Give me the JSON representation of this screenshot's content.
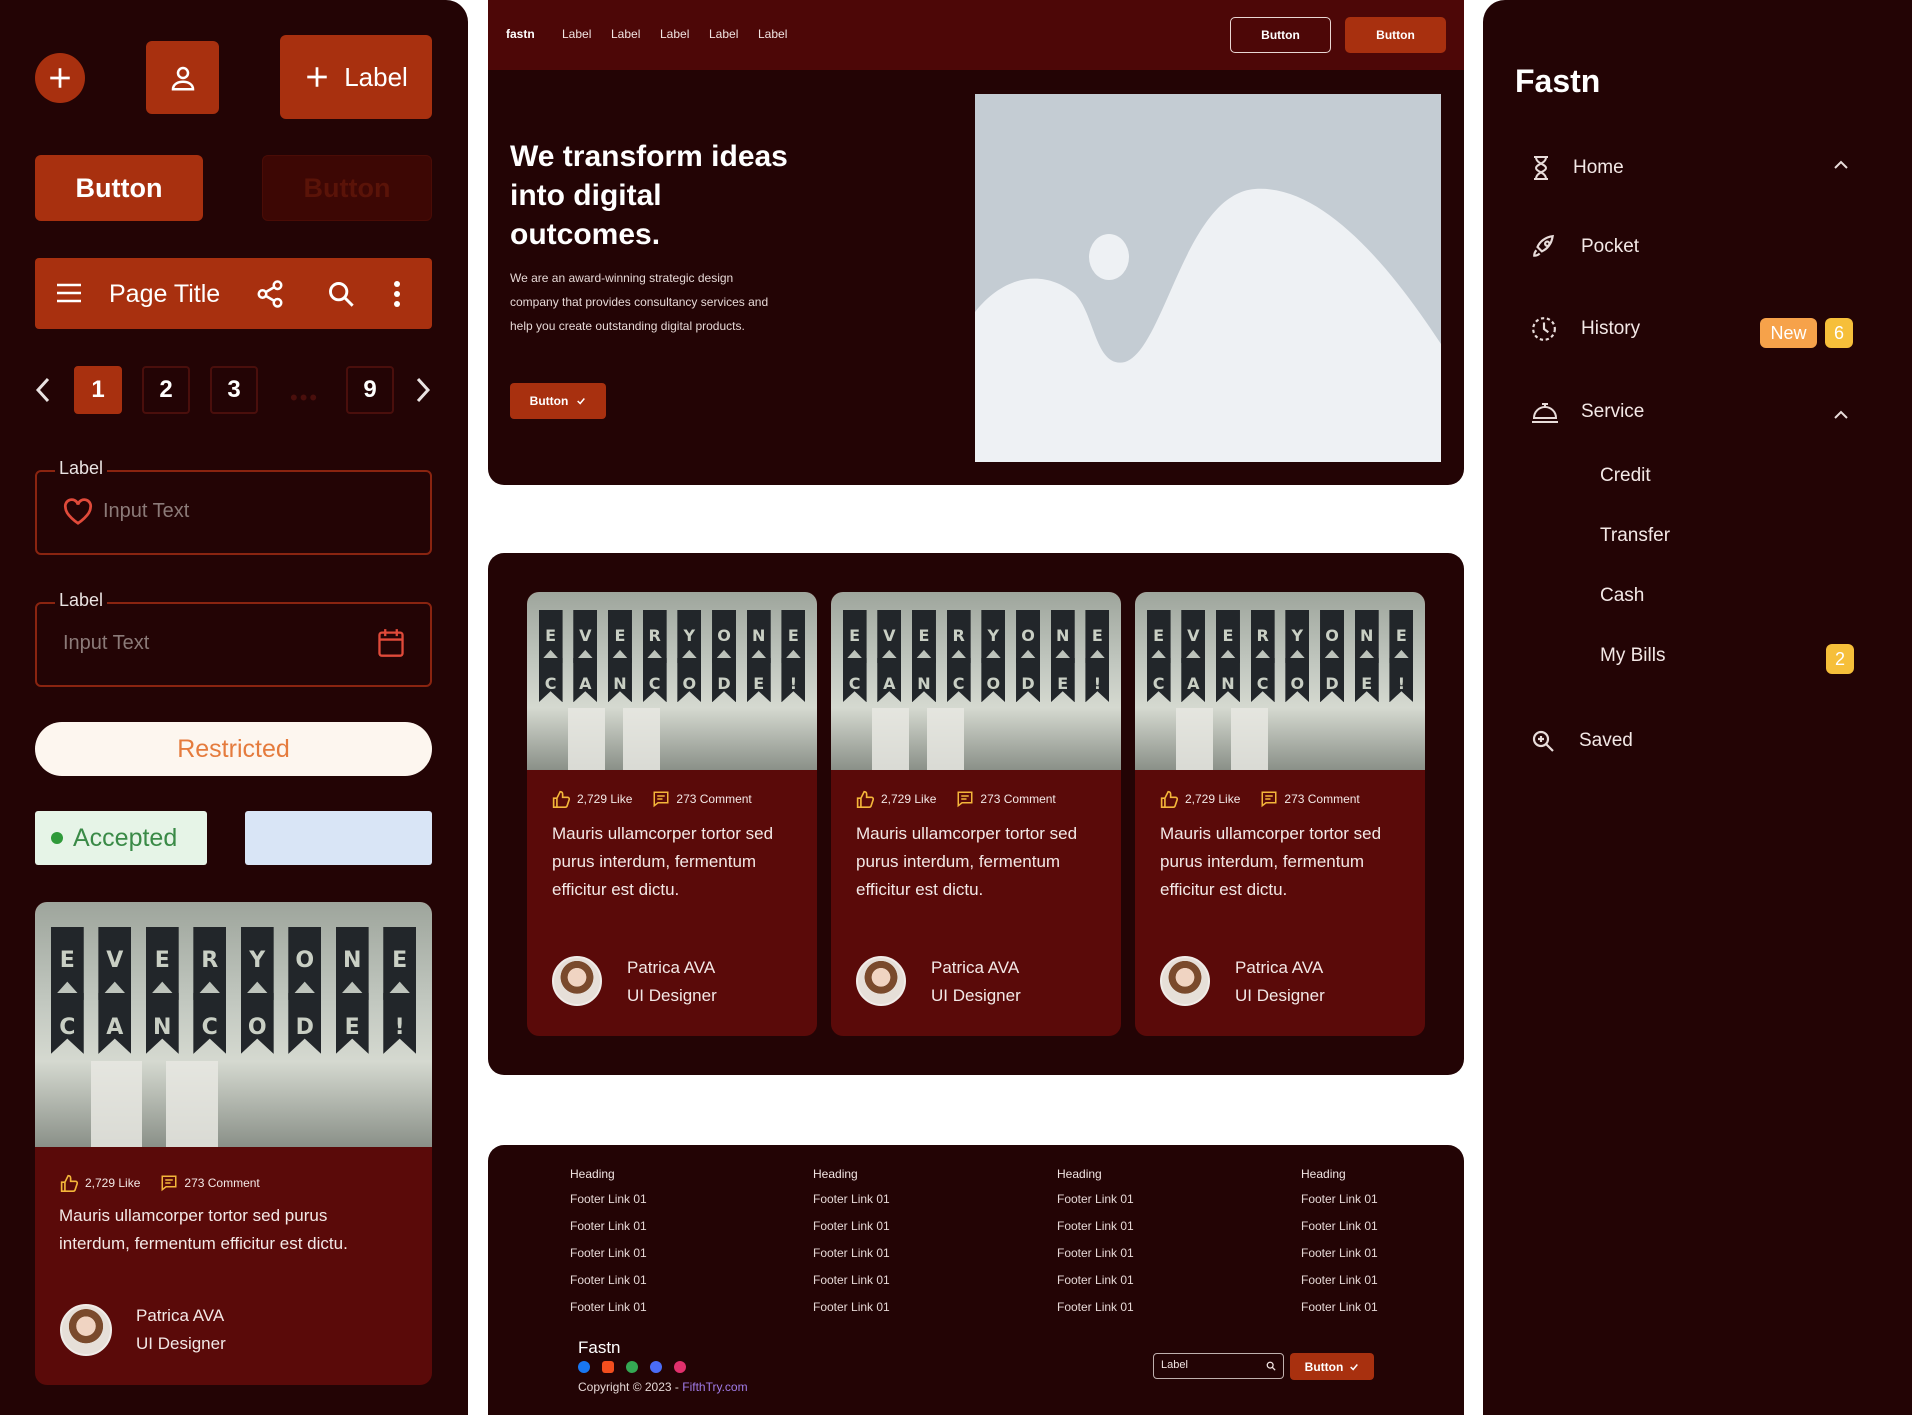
{
  "left": {
    "label_button": "Label",
    "primary_button": "Button",
    "disabled_button": "Button",
    "app_bar_title": "Page Title",
    "pagination": [
      "1",
      "2",
      "3",
      "9"
    ],
    "field1": {
      "label": "Label",
      "value": "Input Text"
    },
    "field2": {
      "label": "Label",
      "value": "Input Text"
    },
    "pill": "Restricted",
    "accepted": "Accepted",
    "card": {
      "likes": "2,729 Like",
      "comments": "273 Comment",
      "text": "Mauris ullamcorper tortor sed purus interdum, fermentum efficitur est dictu.",
      "name": "Patrica AVA",
      "role": "UI Designer"
    }
  },
  "hero": {
    "logo": "fastn",
    "nav": [
      "Label",
      "Label",
      "Label",
      "Label",
      "Label"
    ],
    "btn_outline": "Button",
    "btn_fill": "Button",
    "title": "We transform ideas into digital outcomes.",
    "description": "We are an award-winning strategic design company that provides consultancy services and help you create outstanding digital products.",
    "cta": "Button"
  },
  "cards": [
    {
      "likes": "2,729 Like",
      "comments": "273 Comment",
      "text": "Mauris ullamcorper tortor sed purus interdum, fermentum efficitur est dictu.",
      "name": "Patrica AVA",
      "role": "UI Designer"
    },
    {
      "likes": "2,729 Like",
      "comments": "273 Comment",
      "text": "Mauris ullamcorper tortor sed purus interdum, fermentum efficitur est dictu.",
      "name": "Patrica AVA",
      "role": "UI Designer"
    },
    {
      "likes": "2,729 Like",
      "comments": "273 Comment",
      "text": "Mauris ullamcorper tortor sed purus interdum, fermentum efficitur est dictu.",
      "name": "Patrica AVA",
      "role": "UI Designer"
    }
  ],
  "photo_letters": {
    "top": [
      "E",
      "V",
      "E",
      "R",
      "Y",
      "O",
      "N",
      "E"
    ],
    "bottom": [
      "C",
      "A",
      "N",
      "C",
      "O",
      "D",
      "E",
      "!"
    ]
  },
  "footer": {
    "columns": [
      {
        "heading": "Heading",
        "links": [
          "Footer Link 01",
          "Footer Link 01",
          "Footer Link 01",
          "Footer Link 01",
          "Footer Link 01"
        ]
      },
      {
        "heading": "Heading",
        "links": [
          "Footer Link 01",
          "Footer Link 01",
          "Footer Link 01",
          "Footer Link 01",
          "Footer Link 01"
        ]
      },
      {
        "heading": "Heading",
        "links": [
          "Footer Link 01",
          "Footer Link 01",
          "Footer Link 01",
          "Footer Link 01",
          "Footer Link 01"
        ]
      },
      {
        "heading": "Heading",
        "links": [
          "Footer Link 01",
          "Footer Link 01",
          "Footer Link 01",
          "Footer Link 01",
          "Footer Link 01"
        ]
      }
    ],
    "brand": "Fastn",
    "copyright": "Copyright © 2023 - ",
    "copyright_link": "FifthTry.com",
    "input_value": "Label",
    "button": "Button"
  },
  "sidebar": {
    "brand": "Fastn",
    "items": {
      "home": "Home",
      "pocket": "Pocket",
      "history": "History",
      "history_badge": "New",
      "history_count": "6",
      "service": "Service",
      "credit": "Credit",
      "transfer": "Transfer",
      "cash": "Cash",
      "bills": "My Bills",
      "bills_count": "2",
      "saved": "Saved"
    }
  },
  "colors": {
    "background": "#230405",
    "accent": "#a8300f",
    "card": "#5a0a09",
    "nav_bar": "#4d0707",
    "badge_orange": "#f6a24a",
    "badge_yellow": "#f6bf3a"
  }
}
